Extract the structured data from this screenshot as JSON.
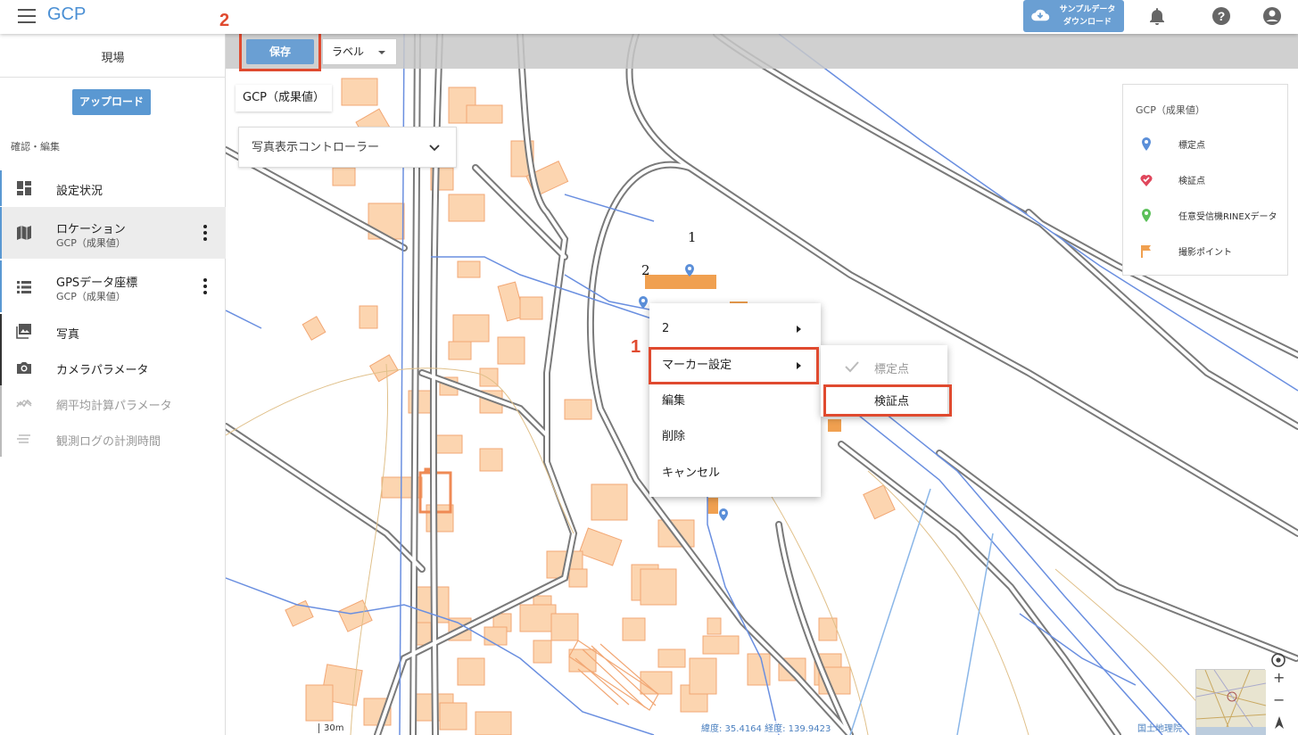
{
  "topbar": {
    "app_title": "GCP",
    "sample_button_line1": "サンプルデータ",
    "sample_button_line2": "ダウンロード",
    "icons": [
      "menu-icon",
      "cloud-download-icon",
      "bell-icon",
      "help-icon",
      "account-icon"
    ]
  },
  "sidebar": {
    "site_label": "現場",
    "upload_label": "アップロード",
    "section_label": "確認・編集",
    "items": [
      {
        "label": "設定状況",
        "sub": "",
        "icon": "dashboard-icon",
        "enabled": true
      },
      {
        "label": "ロケーション",
        "sub": "GCP（成果値）",
        "icon": "map-icon",
        "enabled": true,
        "active": true
      },
      {
        "label": "GPSデータ座標",
        "sub": "GCP（成果値）",
        "icon": "list-icon",
        "enabled": true
      },
      {
        "label": "写真",
        "sub": "",
        "icon": "photo-icon",
        "enabled": true
      },
      {
        "label": "カメラパラメータ",
        "sub": "",
        "icon": "camera-icon",
        "enabled": true
      },
      {
        "label": "網平均計算パラメータ",
        "sub": "",
        "icon": "network-icon",
        "enabled": false
      },
      {
        "label": "観測ログの計測時間",
        "sub": "",
        "icon": "log-icon",
        "enabled": false
      }
    ]
  },
  "map": {
    "toolbar": {
      "save_label": "保存",
      "label_select": "ラベル"
    },
    "layer_chip": "GCP（成果値）",
    "photo_controller": "写真表示コントローラー",
    "legend": {
      "title": "GCP（成果値）",
      "items": [
        {
          "label": "標定点",
          "color": "#5b8fd9",
          "icon": "pin-icon"
        },
        {
          "label": "検証点",
          "color": "#e0475c",
          "icon": "check-pin-icon"
        },
        {
          "label": "任意受信機RINEXデータ",
          "color": "#5cc05a",
          "icon": "pin-icon"
        },
        {
          "label": "撮影ポイント",
          "color": "#f0a050",
          "icon": "flag-icon"
        }
      ]
    },
    "marker_labels": [
      "1",
      "2"
    ],
    "step_numbers": {
      "step1": "1",
      "step2": "2"
    },
    "context_menu": {
      "items": [
        {
          "label": "2",
          "has_submenu": true
        },
        {
          "label": "マーカー設定",
          "has_submenu": true
        },
        {
          "label": "編集",
          "has_submenu": false
        },
        {
          "label": "削除",
          "has_submenu": false
        },
        {
          "label": "キャンセル",
          "has_submenu": false
        }
      ]
    },
    "submenu": {
      "items": [
        {
          "label": "標定点",
          "checked": true,
          "disabled": true
        },
        {
          "label": "検証点",
          "checked": false,
          "disabled": false
        }
      ]
    },
    "scale": "30m",
    "coords": "緯度: 35.4164   経度: 139.9423",
    "attribution": "国土地理院",
    "zoom_in": "+",
    "zoom_out": "−"
  },
  "colors": {
    "accent": "#4a8fd4",
    "button": "#6a9fd3",
    "highlight": "#e04a2f",
    "building": "#fcd5b0",
    "road": "#777777",
    "river": "#6a8fe0"
  }
}
